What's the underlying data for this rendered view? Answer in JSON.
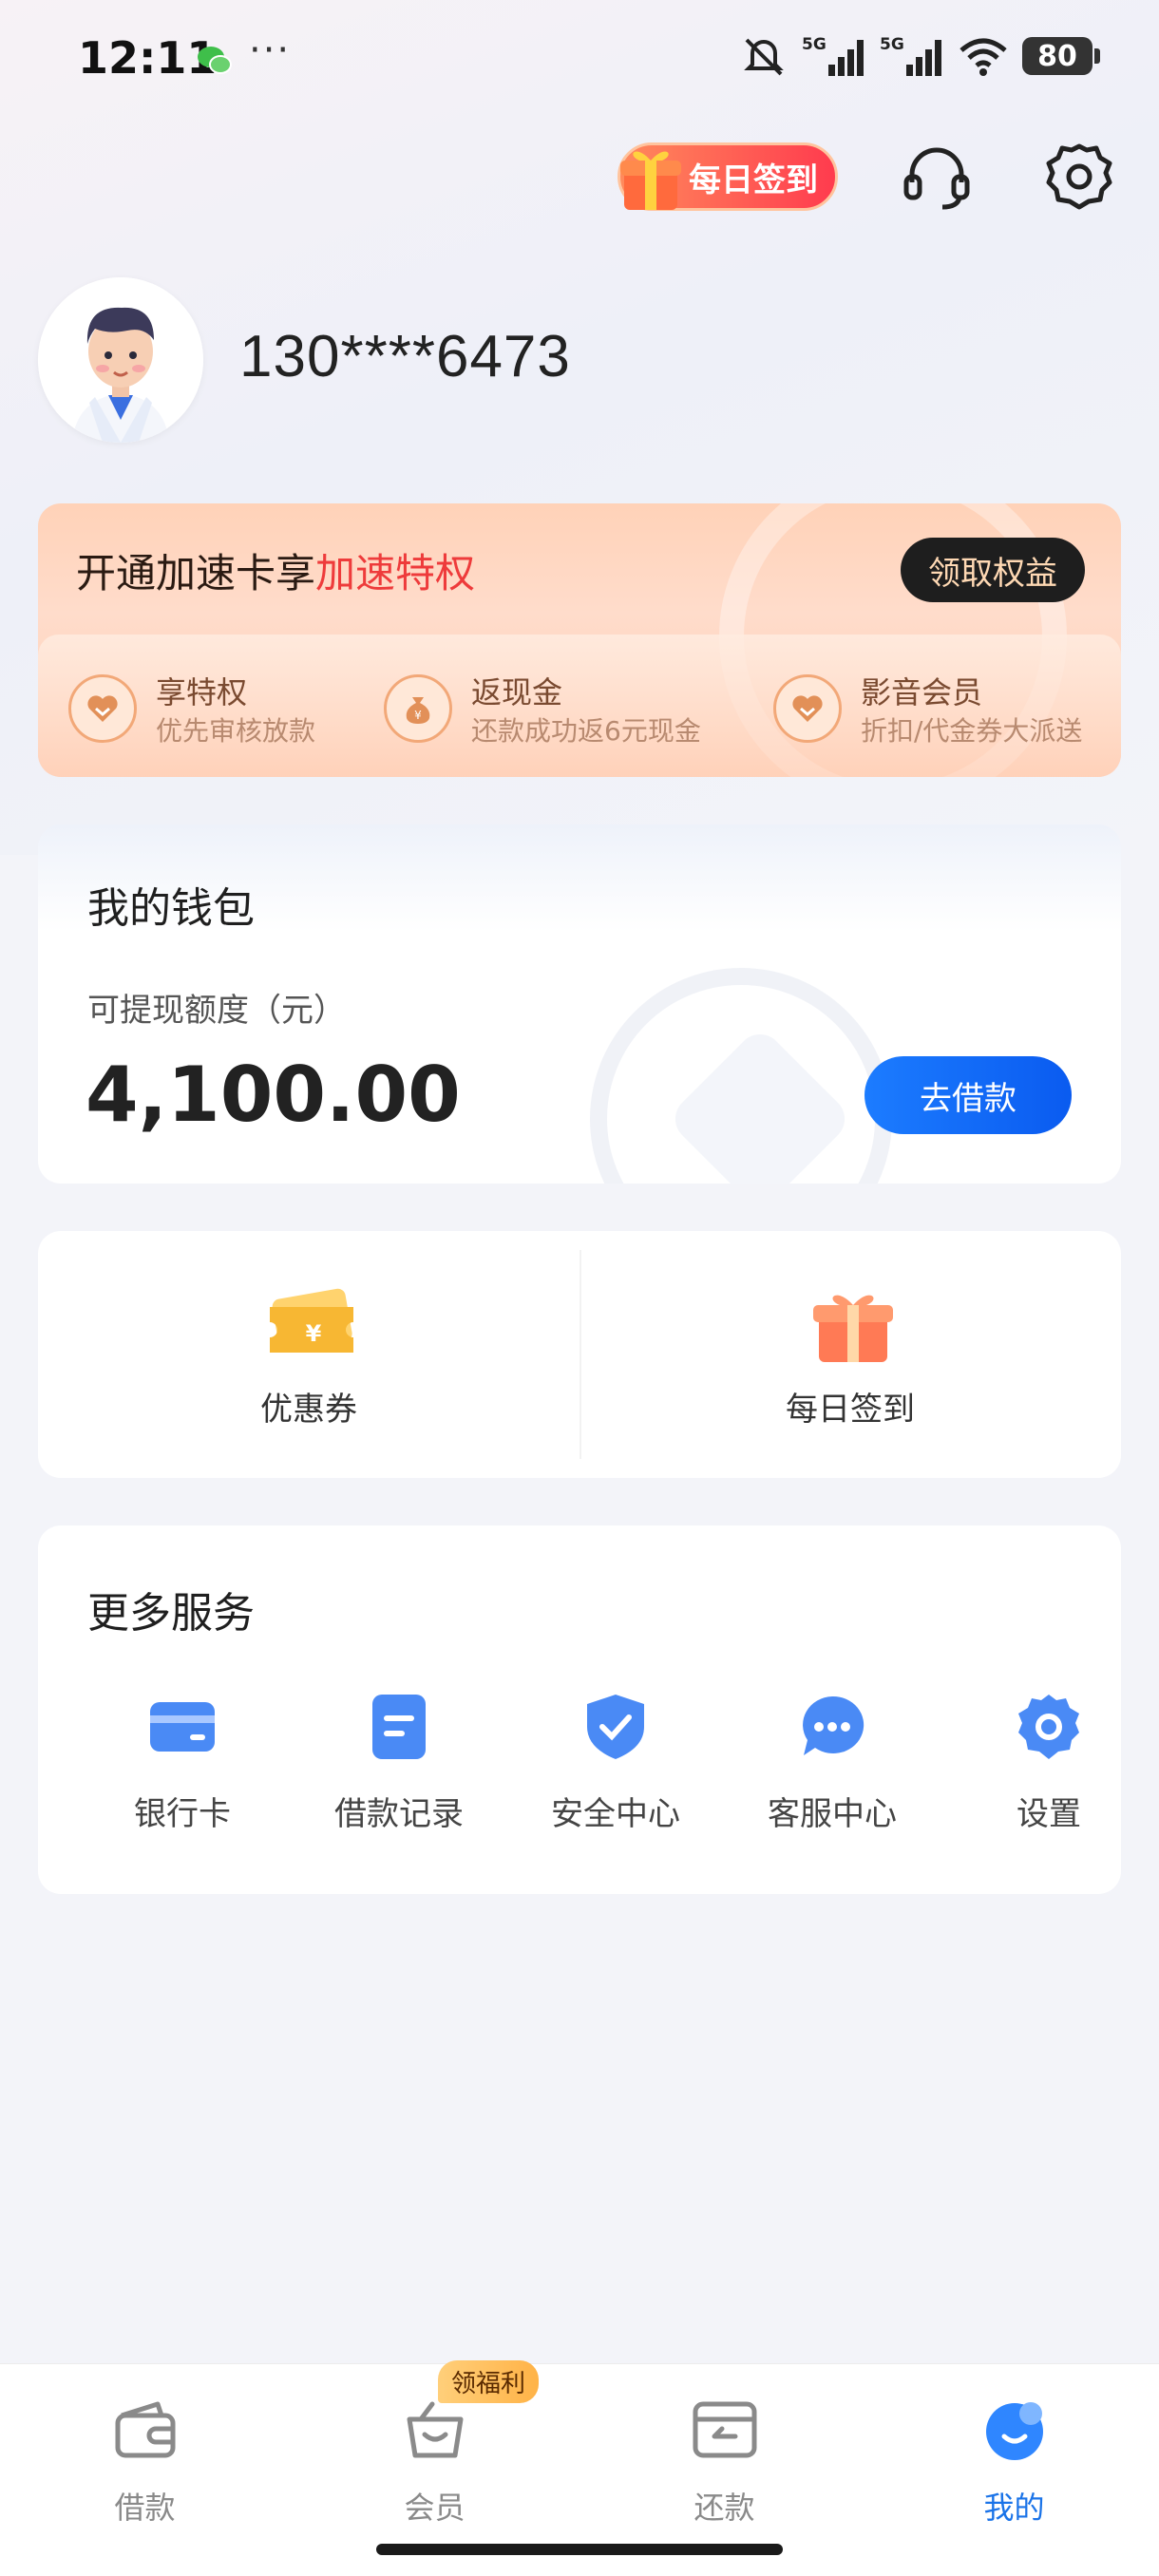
{
  "status_bar": {
    "time": "12:11",
    "dots": "···",
    "network_1": "5G",
    "network_2": "5G",
    "battery": "80"
  },
  "header": {
    "checkin_label": "每日签到"
  },
  "profile": {
    "phone": "130****6473"
  },
  "banner": {
    "title_prefix": "开通加速卡享",
    "title_highlight": "加速特权",
    "button_label": "领取权益",
    "perks": [
      {
        "title": "享特权",
        "desc": "优先审核放款",
        "icon": "heart-shield-icon"
      },
      {
        "title": "返现金",
        "desc": "还款成功返6元现金",
        "icon": "money-bag-icon"
      },
      {
        "title": "影音会员",
        "desc": "折扣/代金券大派送",
        "icon": "heart-shield-icon"
      }
    ]
  },
  "wallet": {
    "title": "我的钱包",
    "label": "可提现额度（元）",
    "amount": "4,100.00",
    "button_label": "去借款"
  },
  "quick": [
    {
      "label": "优惠券",
      "icon": "coupon-icon"
    },
    {
      "label": "每日签到",
      "icon": "gift-icon"
    }
  ],
  "services": {
    "title": "更多服务",
    "items": [
      {
        "label": "银行卡",
        "icon": "bank-card-icon"
      },
      {
        "label": "借款记录",
        "icon": "record-icon"
      },
      {
        "label": "安全中心",
        "icon": "shield-check-icon"
      },
      {
        "label": "客服中心",
        "icon": "chat-icon"
      },
      {
        "label": "设置",
        "icon": "settings-icon"
      }
    ]
  },
  "tabbar": {
    "badge": "领福利",
    "tabs": [
      {
        "label": "借款",
        "icon": "wallet-icon"
      },
      {
        "label": "会员",
        "icon": "basket-icon"
      },
      {
        "label": "还款",
        "icon": "repay-icon"
      },
      {
        "label": "我的",
        "icon": "profile-icon",
        "active": true
      }
    ]
  },
  "colors": {
    "primary": "#1a73e8",
    "highlight": "#ee3b3b",
    "banner_bg": "#ffd2b8"
  }
}
